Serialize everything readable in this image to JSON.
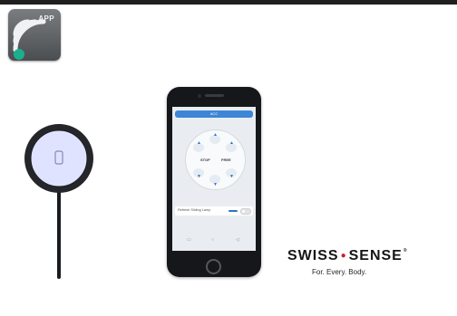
{
  "app_badge": {
    "label": "APP",
    "icon": "wireless-signal-icon",
    "colors": {
      "tile": "#5f6265",
      "arcs": "#f0f1f2",
      "dot": "#1bb08d"
    }
  },
  "phone": {
    "screen_title": "ACC",
    "buttons": {
      "left": "STOP",
      "right": "FREE"
    },
    "toggle_label": "Refresh Sliding Lamp",
    "nav_icons": [
      "menu-icon",
      "home-icon",
      "back-icon"
    ]
  },
  "remote": {
    "icon": "remote-puck-icon",
    "colors": {
      "face": "#dfe3ff",
      "ring": "#25262a"
    }
  },
  "brand": {
    "name_part1": "SWISS",
    "name_part2": "SENSE",
    "reg": "®",
    "tagline": "For. Every. Body.",
    "accent": "#cc1f2d"
  }
}
